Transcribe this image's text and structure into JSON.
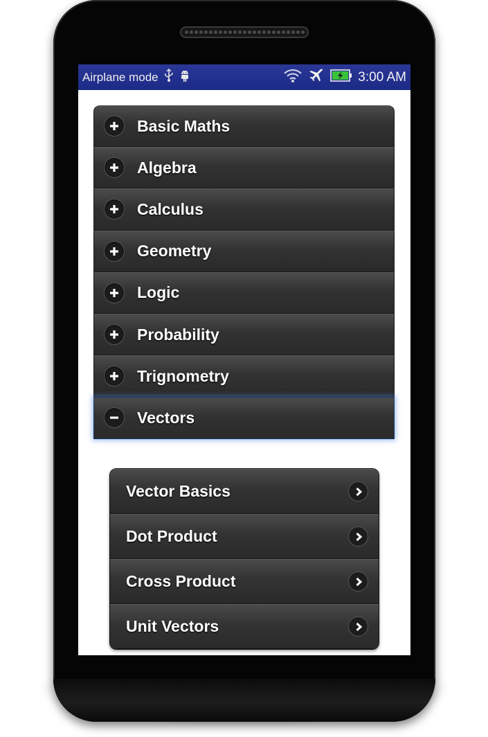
{
  "status_bar": {
    "mode_text": "Airplane mode",
    "time": "3:00 AM",
    "icons": [
      "usb-icon",
      "android-debug-icon",
      "wifi-icon",
      "airplane-icon",
      "battery-charging-icon"
    ],
    "background_color": "#1c2a87",
    "battery_color": "#3ac33a"
  },
  "accordion": {
    "items": [
      {
        "label": "Basic Maths",
        "state": "collapsed",
        "icon": "plus-icon"
      },
      {
        "label": "Algebra",
        "state": "collapsed",
        "icon": "plus-icon"
      },
      {
        "label": "Calculus",
        "state": "collapsed",
        "icon": "plus-icon"
      },
      {
        "label": "Geometry",
        "state": "collapsed",
        "icon": "plus-icon"
      },
      {
        "label": "Logic",
        "state": "collapsed",
        "icon": "plus-icon"
      },
      {
        "label": "Probability",
        "state": "collapsed",
        "icon": "plus-icon"
      },
      {
        "label": "Trignometry",
        "state": "collapsed",
        "icon": "plus-icon"
      },
      {
        "label": "Vectors",
        "state": "expanded",
        "icon": "minus-icon"
      }
    ]
  },
  "sublist": {
    "items": [
      {
        "label": "Vector Basics",
        "icon": "chevron-right-icon"
      },
      {
        "label": "Dot Product",
        "icon": "chevron-right-icon"
      },
      {
        "label": "Cross Product",
        "icon": "chevron-right-icon"
      },
      {
        "label": "Unit Vectors",
        "icon": "chevron-right-icon"
      }
    ]
  },
  "colors": {
    "item_background": "#333333",
    "expanded_glow": "#5a8ce6",
    "text": "#ffffff"
  }
}
